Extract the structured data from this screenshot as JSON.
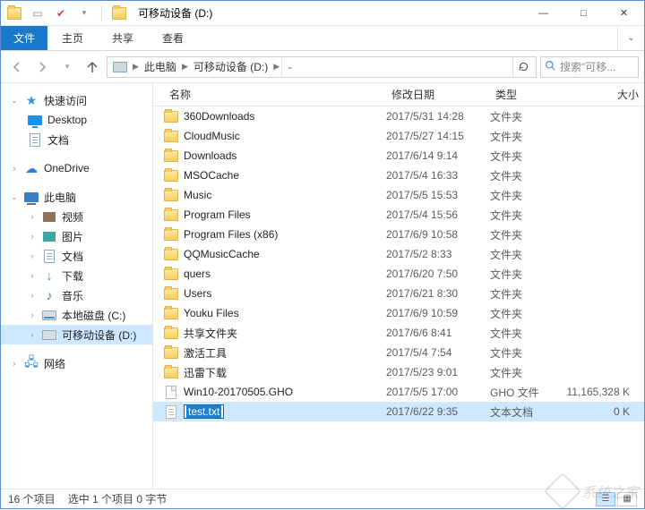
{
  "window": {
    "title": "可移动设备 (D:)",
    "min": "—",
    "max": "□",
    "close": "✕"
  },
  "ribbon": {
    "file": "文件",
    "tabs": [
      "主页",
      "共享",
      "查看"
    ]
  },
  "nav": {
    "crumbs": [
      "此电脑",
      "可移动设备 (D:)"
    ],
    "search_placeholder": "搜索\"可移..."
  },
  "sidebar": {
    "quick": "快速访问",
    "desktop": "Desktop",
    "docs": "文档",
    "onedrive": "OneDrive",
    "thispc": "此电脑",
    "video": "视频",
    "pics": "图片",
    "docs2": "文档",
    "down": "下载",
    "music": "音乐",
    "cdrive": "本地磁盘 (C:)",
    "ddrive": "可移动设备 (D:)",
    "network": "网络"
  },
  "columns": {
    "name": "名称",
    "date": "修改日期",
    "type": "类型",
    "size": "大小"
  },
  "files": [
    {
      "name": "360Downloads",
      "date": "2017/5/31 14:28",
      "type": "文件夹",
      "size": "",
      "kind": "folder"
    },
    {
      "name": "CloudMusic",
      "date": "2017/5/27 14:15",
      "type": "文件夹",
      "size": "",
      "kind": "folder"
    },
    {
      "name": "Downloads",
      "date": "2017/6/14 9:14",
      "type": "文件夹",
      "size": "",
      "kind": "folder"
    },
    {
      "name": "MSOCache",
      "date": "2017/5/4 16:33",
      "type": "文件夹",
      "size": "",
      "kind": "folder"
    },
    {
      "name": "Music",
      "date": "2017/5/5 15:53",
      "type": "文件夹",
      "size": "",
      "kind": "folder"
    },
    {
      "name": "Program Files",
      "date": "2017/5/4 15:56",
      "type": "文件夹",
      "size": "",
      "kind": "folder"
    },
    {
      "name": "Program Files (x86)",
      "date": "2017/6/9 10:58",
      "type": "文件夹",
      "size": "",
      "kind": "folder"
    },
    {
      "name": "QQMusicCache",
      "date": "2017/5/2 8:33",
      "type": "文件夹",
      "size": "",
      "kind": "folder"
    },
    {
      "name": "quers",
      "date": "2017/6/20 7:50",
      "type": "文件夹",
      "size": "",
      "kind": "folder"
    },
    {
      "name": "Users",
      "date": "2017/6/21 8:30",
      "type": "文件夹",
      "size": "",
      "kind": "folder"
    },
    {
      "name": "Youku Files",
      "date": "2017/6/9 10:59",
      "type": "文件夹",
      "size": "",
      "kind": "folder"
    },
    {
      "name": "共享文件夹",
      "date": "2017/6/6 8:41",
      "type": "文件夹",
      "size": "",
      "kind": "folder"
    },
    {
      "name": "激活工具",
      "date": "2017/5/4 7:54",
      "type": "文件夹",
      "size": "",
      "kind": "folder"
    },
    {
      "name": "迅雷下载",
      "date": "2017/5/23 9:01",
      "type": "文件夹",
      "size": "",
      "kind": "folder"
    },
    {
      "name": "Win10-20170505.GHO",
      "date": "2017/5/5 17:00",
      "type": "GHO 文件",
      "size": "11,165,328 K",
      "kind": "file"
    },
    {
      "name": "test.txt",
      "date": "2017/6/22 9:35",
      "type": "文本文档",
      "size": "0 K",
      "kind": "txt",
      "renaming": true
    }
  ],
  "status": {
    "count": "16 个项目",
    "selected": "选中 1 个项目 0 字节"
  },
  "watermark": "系统之家"
}
